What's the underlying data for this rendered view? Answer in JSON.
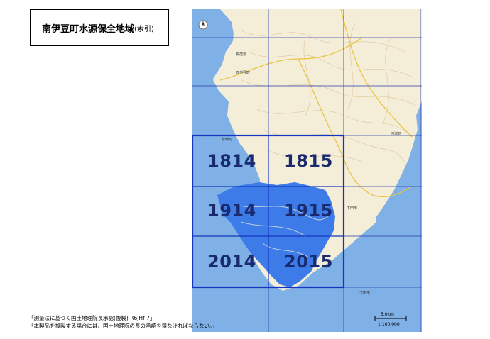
{
  "title": {
    "main": "南伊豆町水源保全地域",
    "sub": "(索引)"
  },
  "tiles": [
    {
      "id": "1814"
    },
    {
      "id": "1815"
    },
    {
      "id": "1914"
    },
    {
      "id": "1915"
    },
    {
      "id": "2014"
    },
    {
      "id": "2015"
    }
  ],
  "notes": {
    "line1": "「測量法に基づく国土地理院長承認(複製) R6JHf 7」",
    "line2": "「本製品を複製する場合には、国土地理院の長の承認を得なければならない。」"
  },
  "scale": {
    "distance": "5.0km",
    "ratio": "1:100,000"
  },
  "places": {
    "matsuzaki": "松崎町",
    "nishiizu": "西伊豆町",
    "kawazu": "河津町",
    "shimoda": "下田市",
    "shimoda2": "下田市",
    "kamo": "賀茂郡"
  },
  "colors": {
    "sea": "#7fb0e6",
    "land": "#f4eed9",
    "conservation_area": "#3d7ce8",
    "index_frame": "#1535c0",
    "grid": "#2b3fb0",
    "tile_label": "#1a2a6e"
  }
}
